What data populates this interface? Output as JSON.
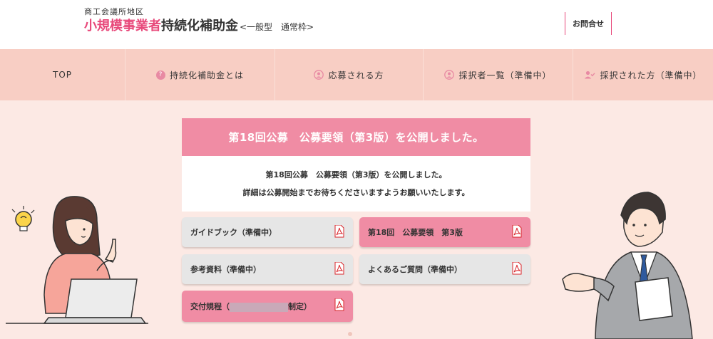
{
  "header": {
    "org": "商工会議所地区",
    "title_pink": "小規模事業者",
    "title_dark": "持続化補助金",
    "title_small": "<一般型　通常枠>",
    "contact_label": "お問合せ"
  },
  "nav": {
    "items": [
      {
        "label": "TOP",
        "icon": ""
      },
      {
        "label": "持続化補助金とは",
        "icon": "question-icon"
      },
      {
        "label": "応募される方",
        "icon": "user-icon"
      },
      {
        "label": "採択者一覧（準備中）",
        "icon": "user-icon"
      },
      {
        "label": "採択された方（準備中）",
        "icon": "user-check-icon"
      }
    ]
  },
  "notice": {
    "heading": "第18回公募　公募要領（第3版）を公開しました。",
    "line1": "第18回公募　公募要領（第3版）を公開しました。",
    "line2": "詳細は公募開始までお待ちくださいますようお願いいたします。"
  },
  "docs": {
    "guidebook": "ガイドブック（準備中）",
    "youryou": "第18回　公募要領　第3版",
    "sankou": "参考資料（準備中）",
    "faq": "よくあるご質問（準備中）",
    "kofu_prefix": "交付規程（",
    "kofu_suffix": "制定）"
  },
  "colors": {
    "accent": "#e8497b",
    "nav_bg": "#f8cec4",
    "page_bg": "#fce9e4",
    "card_head": "#f08ca4",
    "pdf_red": "#d9262b"
  }
}
